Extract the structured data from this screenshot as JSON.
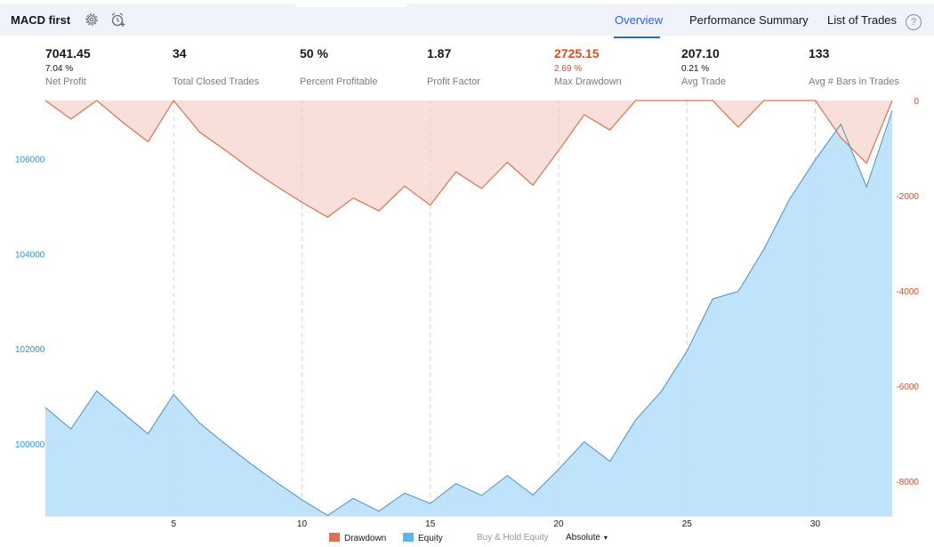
{
  "header": {
    "strategy_name": "MACD first",
    "settings_icon": "gear-icon",
    "alert_icon": "alarm-clock-plus-icon",
    "tabs": [
      {
        "label": "Overview",
        "active": true
      },
      {
        "label": "Performance Summary",
        "active": false
      },
      {
        "label": "List of Trades",
        "active": false
      }
    ],
    "help_label": "?",
    "accent_color": "#2962ff"
  },
  "stats": [
    {
      "value": "7041.45",
      "percent": "7.04 %",
      "label": "Net Profit",
      "negative": false
    },
    {
      "value": "34",
      "percent": "",
      "label": "Total Closed Trades",
      "negative": false
    },
    {
      "value": "50 %",
      "percent": "",
      "label": "Percent Profitable",
      "negative": false
    },
    {
      "value": "1.87",
      "percent": "",
      "label": "Profit Factor",
      "negative": false
    },
    {
      "value": "2725.15",
      "percent": "2.69 %",
      "label": "Max Drawdown",
      "negative": true
    },
    {
      "value": "207.10",
      "percent": "0.21 %",
      "label": "Avg Trade",
      "negative": false
    },
    {
      "value": "133",
      "percent": "",
      "label": "Avg # Bars in Trades",
      "negative": false
    }
  ],
  "chart_data": {
    "type": "area",
    "x": [
      0,
      1,
      2,
      3,
      4,
      5,
      6,
      7,
      8,
      9,
      10,
      11,
      12,
      13,
      14,
      15,
      16,
      17,
      18,
      19,
      20,
      21,
      22,
      23,
      24,
      25,
      26,
      27,
      28,
      29,
      30,
      31,
      32,
      33
    ],
    "xlim": [
      0,
      33
    ],
    "x_ticks": [
      "5",
      "10",
      "15",
      "20",
      "25",
      "30"
    ],
    "x_tick_values": [
      5,
      10,
      15,
      20,
      25,
      30
    ],
    "series": [
      {
        "name": "Equity",
        "axis": "left",
        "color": "#5eb4ee",
        "fill": "#bfe3fb",
        "values": [
          100780,
          100330,
          101130,
          100680,
          100230,
          101060,
          100460,
          100020,
          99600,
          99210,
          98840,
          98510,
          98870,
          98600,
          98980,
          98760,
          99180,
          98930,
          99350,
          98940,
          99480,
          100060,
          99650,
          100520,
          101120,
          101970,
          103070,
          103230,
          104120,
          105170,
          106000,
          106750,
          105430,
          107040
        ]
      },
      {
        "name": "Drawdown",
        "axis": "right",
        "color": "#e0714f",
        "fill": "#f8dfd9",
        "values": [
          0,
          -390,
          0,
          -450,
          -870,
          0,
          -660,
          -1040,
          -1440,
          -1800,
          -2140,
          -2450,
          -2050,
          -2320,
          -1800,
          -2200,
          -1500,
          -1850,
          -1300,
          -1780,
          -1050,
          -300,
          -620,
          0,
          0,
          0,
          0,
          -560,
          0,
          0,
          0,
          -780,
          -1320,
          0
        ]
      }
    ],
    "y_left": {
      "ticks": [
        "100000",
        "102000",
        "104000",
        "106000"
      ],
      "tick_values": [
        100000,
        102000,
        104000,
        106000
      ],
      "range": [
        98500,
        107250
      ],
      "color": "#2196f3"
    },
    "y_right": {
      "ticks": [
        "0",
        "-2000",
        "-4000",
        "-6000",
        "-8000"
      ],
      "tick_values": [
        0,
        -2000,
        -4000,
        -6000,
        -8000
      ],
      "range": [
        -8730,
        0
      ],
      "color": "#e04b26"
    },
    "grid": "vertical-dashed",
    "legend_position": "bottom"
  },
  "legend": {
    "drawdown_label": "Drawdown",
    "equity_label": "Equity",
    "buy_hold_label": "Buy & Hold Equity",
    "mode_label": "Absolute",
    "mode_caret": "▾"
  }
}
